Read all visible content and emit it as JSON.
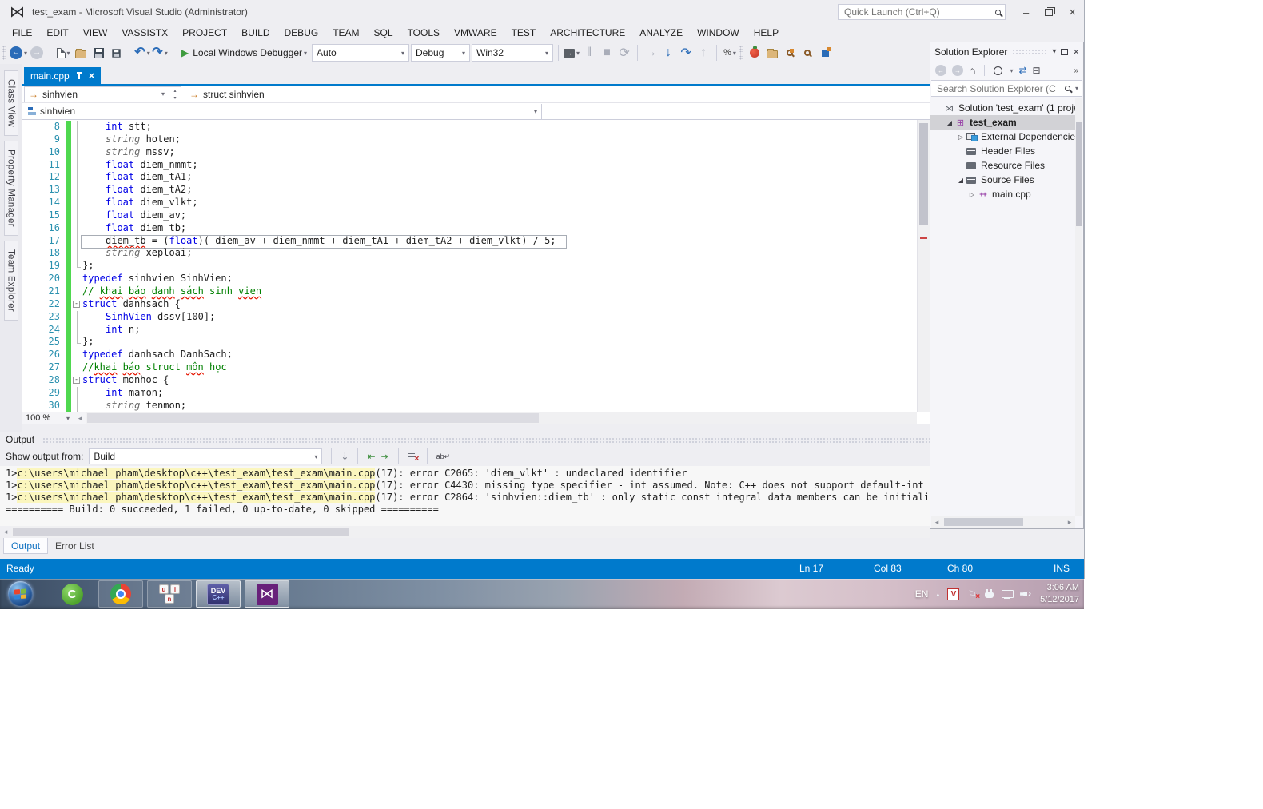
{
  "window": {
    "title": "test_exam - Microsoft Visual Studio (Administrator)",
    "quick_launch_placeholder": "Quick Launch (Ctrl+Q)"
  },
  "menu": {
    "items": [
      "FILE",
      "EDIT",
      "VIEW",
      "VASSISTX",
      "PROJECT",
      "BUILD",
      "DEBUG",
      "TEAM",
      "SQL",
      "TOOLS",
      "VMWARE",
      "TEST",
      "ARCHITECTURE",
      "ANALYZE",
      "WINDOW",
      "HELP"
    ]
  },
  "toolbar": {
    "debug_target": "Local Windows Debugger",
    "combo_auto": "Auto",
    "combo_config": "Debug",
    "combo_platform": "Win32"
  },
  "side_tabs": {
    "items": [
      "Class View",
      "Property Manager",
      "Team Explorer"
    ]
  },
  "editor": {
    "tab": "main.cpp",
    "nav_scope": "sinhvien",
    "nav_context": "struct sinhvien",
    "nav_member": "sinhvien",
    "zoom": "100 %"
  },
  "icons": {
    "run": "▶",
    "undo": "↶",
    "redo": "↷",
    "back": "←",
    "forward": "→",
    "dropdown": "▾",
    "close": "×",
    "minimize": "–",
    "home": "⌂",
    "sync": "⇄",
    "collapse_all": "⊟",
    "expand_open": "◢",
    "expand_closed": "▷",
    "pause": "‖",
    "stop": "■",
    "restart": "⟳",
    "vs_logo": "⋈",
    "overflow": "»",
    "left_arrow": "◂",
    "right_arrow": "▸",
    "up_arrow": "▴"
  },
  "code": {
    "lines": [
      {
        "n": 8,
        "i": 1,
        "f": "v",
        "tk": [
          [
            "k",
            "int"
          ],
          [
            "p",
            " stt;"
          ]
        ]
      },
      {
        "n": 9,
        "i": 1,
        "f": "v",
        "tk": [
          [
            "t",
            "string"
          ],
          [
            "p",
            " hoten;"
          ]
        ]
      },
      {
        "n": 10,
        "i": 1,
        "f": "v",
        "tk": [
          [
            "t",
            "string"
          ],
          [
            "p",
            " mssv;"
          ]
        ]
      },
      {
        "n": 11,
        "i": 1,
        "f": "v",
        "tk": [
          [
            "k",
            "float"
          ],
          [
            "p",
            " diem_nmmt;"
          ]
        ]
      },
      {
        "n": 12,
        "i": 1,
        "f": "v",
        "tk": [
          [
            "k",
            "float"
          ],
          [
            "p",
            " diem_tA1;"
          ]
        ]
      },
      {
        "n": 13,
        "i": 1,
        "f": "v",
        "tk": [
          [
            "k",
            "float"
          ],
          [
            "p",
            " diem_tA2;"
          ]
        ]
      },
      {
        "n": 14,
        "i": 1,
        "f": "v",
        "tk": [
          [
            "k",
            "float"
          ],
          [
            "p",
            " diem_vlkt;"
          ]
        ]
      },
      {
        "n": 15,
        "i": 1,
        "f": "v",
        "tk": [
          [
            "k",
            "float"
          ],
          [
            "p",
            " diem_av;"
          ]
        ]
      },
      {
        "n": 16,
        "i": 1,
        "f": "v",
        "tk": [
          [
            "k",
            "float"
          ],
          [
            "p",
            " diem_tb;"
          ]
        ]
      },
      {
        "n": 17,
        "i": 1,
        "f": "v",
        "box": true,
        "tk": [
          [
            "e",
            "diem_tb"
          ],
          [
            "p",
            " = ("
          ],
          [
            "k",
            "float"
          ],
          [
            "p",
            ")( diem_av + diem_nmmt + diem_tA1 + diem_tA2 + diem_vlkt) / 5;"
          ]
        ]
      },
      {
        "n": 18,
        "i": 1,
        "f": "v",
        "tk": [
          [
            "t",
            "string"
          ],
          [
            "p",
            " xeploai;"
          ]
        ]
      },
      {
        "n": 19,
        "i": 0,
        "f": "e",
        "tk": [
          [
            "p",
            "};"
          ]
        ]
      },
      {
        "n": 20,
        "i": 0,
        "tk": [
          [
            "k",
            "typedef"
          ],
          [
            "p",
            " sinhvien SinhVien;"
          ]
        ]
      },
      {
        "n": 21,
        "i": 0,
        "tk": [
          [
            "c",
            "// "
          ],
          [
            "w",
            "khai"
          ],
          [
            "c",
            " "
          ],
          [
            "w",
            "báo"
          ],
          [
            "c",
            " "
          ],
          [
            "w",
            "danh"
          ],
          [
            "c",
            " "
          ],
          [
            "w",
            "sách"
          ],
          [
            "c",
            " sinh "
          ],
          [
            "w",
            "vien"
          ]
        ]
      },
      {
        "n": 22,
        "i": 0,
        "f": "o",
        "tk": [
          [
            "k",
            "struct"
          ],
          [
            "p",
            " danhsach {"
          ]
        ]
      },
      {
        "n": 23,
        "i": 1,
        "f": "v",
        "tk": [
          [
            "k",
            "SinhVien"
          ],
          [
            "p",
            " dssv[100];"
          ]
        ]
      },
      {
        "n": 24,
        "i": 1,
        "f": "v",
        "tk": [
          [
            "k",
            "int"
          ],
          [
            "p",
            " n;"
          ]
        ]
      },
      {
        "n": 25,
        "i": 0,
        "f": "e",
        "tk": [
          [
            "p",
            "};"
          ]
        ]
      },
      {
        "n": 26,
        "i": 0,
        "tk": [
          [
            "k",
            "typedef"
          ],
          [
            "p",
            " danhsach DanhSach;"
          ]
        ]
      },
      {
        "n": 27,
        "i": 0,
        "tk": [
          [
            "c",
            "//"
          ],
          [
            "w",
            "khai"
          ],
          [
            "c",
            " "
          ],
          [
            "w",
            "báo"
          ],
          [
            "c",
            " struct "
          ],
          [
            "w",
            "môn"
          ],
          [
            "c",
            " học"
          ]
        ]
      },
      {
        "n": 28,
        "i": 0,
        "f": "o",
        "tk": [
          [
            "k",
            "struct"
          ],
          [
            "p",
            " monhoc {"
          ]
        ]
      },
      {
        "n": 29,
        "i": 1,
        "f": "v",
        "tk": [
          [
            "k",
            "int"
          ],
          [
            "p",
            " mamon;"
          ]
        ]
      },
      {
        "n": 30,
        "i": 1,
        "f": "v",
        "tk": [
          [
            "t",
            "string"
          ],
          [
            "p",
            " tenmon;"
          ]
        ]
      }
    ]
  },
  "solution_explorer": {
    "title": "Solution Explorer",
    "search_placeholder": "Search Solution Explorer (C",
    "items": [
      {
        "icon": "solution",
        "label": "Solution 'test_exam' (1 proje",
        "indent": 0,
        "arrow": null,
        "bold": false,
        "selected": false
      },
      {
        "icon": "project",
        "label": "test_exam",
        "indent": 1,
        "arrow": "open",
        "bold": true,
        "selected": true
      },
      {
        "icon": "deps",
        "label": "External Dependencie",
        "indent": 2,
        "arrow": "closed",
        "bold": false,
        "selected": false
      },
      {
        "icon": "folder",
        "label": "Header Files",
        "indent": 2,
        "arrow": null,
        "bold": false,
        "selected": false
      },
      {
        "icon": "folder",
        "label": "Resource Files",
        "indent": 2,
        "arrow": null,
        "bold": false,
        "selected": false
      },
      {
        "icon": "folder",
        "label": "Source Files",
        "indent": 2,
        "arrow": "open",
        "bold": false,
        "selected": false
      },
      {
        "icon": "cpp",
        "label": "main.cpp",
        "indent": 3,
        "arrow": "closed",
        "bold": false,
        "selected": false
      }
    ]
  },
  "output": {
    "title": "Output",
    "show_output_from": "Show output from:",
    "source": "Build",
    "lines": [
      {
        "prefix": "1>",
        "path": "c:\\users\\michael pham\\desktop\\c++\\test_exam\\test_exam\\main.cpp",
        "rest": "(17): error C2065: 'diem_vlkt' : undeclared identifier"
      },
      {
        "prefix": "1>",
        "path": "c:\\users\\michael pham\\desktop\\c++\\test_exam\\test_exam\\main.cpp",
        "rest": "(17): error C4430: missing type specifier - int assumed. Note: C++ does not support default-int"
      },
      {
        "prefix": "1>",
        "path": "c:\\users\\michael pham\\desktop\\c++\\test_exam\\test_exam\\main.cpp",
        "rest": "(17): error C2864: 'sinhvien::diem_tb' : only static const integral data members can be initializ"
      }
    ],
    "summary": "========== Build: 0 succeeded, 1 failed, 0 up-to-date, 0 skipped ==========",
    "tabs": [
      "Output",
      "Error List"
    ]
  },
  "status_bar": {
    "ready": "Ready",
    "ln": "Ln 17",
    "col": "Col 83",
    "ch": "Ch 80",
    "ins": "INS"
  },
  "taskbar": {
    "tray_lang": "EN",
    "clock_time": "3:06 AM",
    "clock_date": "5/12/2017",
    "dev_label1": "DEV",
    "dev_label2": "C++",
    "coc_label": "C",
    "unikey_keys": [
      "u",
      "i",
      "n"
    ]
  }
}
